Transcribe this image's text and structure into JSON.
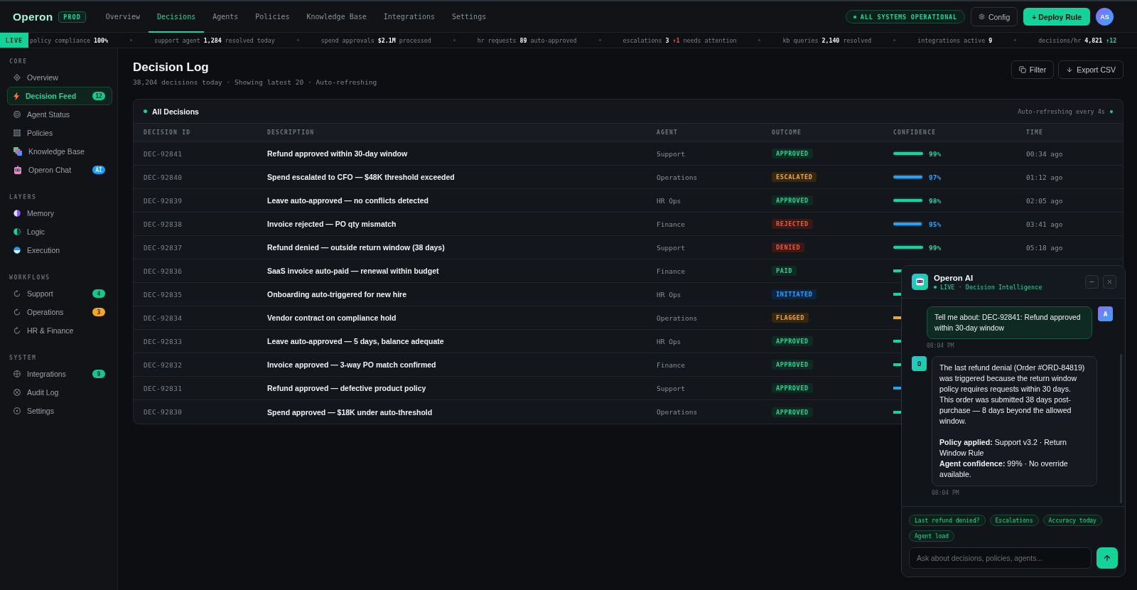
{
  "top_bar": {
    "logo": "Operon",
    "env_badge": "PROD",
    "tabs": [
      {
        "label": "Overview",
        "selected": false
      },
      {
        "label": "Decisions",
        "selected": true
      },
      {
        "label": "Agents",
        "selected": false
      },
      {
        "label": "Policies",
        "selected": false
      },
      {
        "label": "Knowledge Base",
        "selected": false
      },
      {
        "label": "Integrations",
        "selected": false
      },
      {
        "label": "Settings",
        "selected": false
      }
    ],
    "status": "ALL SYSTEMS OPERATIONAL",
    "config_button": "Config",
    "deploy_button": "+ Deploy Rule",
    "avatar": "AS"
  },
  "ticker": {
    "live_badge": "LIVE",
    "items": [
      {
        "label": "policy compliance",
        "value": "100%"
      },
      {
        "label": "support agent",
        "value": "1,284",
        "suffix": "resolved today"
      },
      {
        "label": "spend approvals",
        "value": "$2.1M",
        "suffix": "processed"
      },
      {
        "label": "hr requests",
        "value": "89",
        "suffix": "auto-approved"
      },
      {
        "label": "escalations",
        "value": "3",
        "delta": {
          "text": "↑1",
          "kind": "negative"
        },
        "suffix": "needs attention"
      },
      {
        "label": "kb queries",
        "value": "2,140",
        "suffix": "resolved"
      },
      {
        "label": "integrations active",
        "value": "9"
      },
      {
        "label": "decisions/hr",
        "value": "4,821",
        "delta": {
          "text": "↑12",
          "kind": "positive"
        }
      }
    ]
  },
  "sidebar": {
    "sections": [
      {
        "title": "CORE",
        "items": [
          {
            "label": "Overview",
            "selected": false
          },
          {
            "label": "Decision Feed",
            "selected": true,
            "badge": {
              "text": "12",
              "kind": "success"
            }
          },
          {
            "label": "Agent Status",
            "selected": false
          },
          {
            "label": "Policies",
            "selected": false
          },
          {
            "label": "Knowledge Base",
            "selected": false
          },
          {
            "label": "Operon Chat",
            "selected": false,
            "badge": {
              "text": "AI",
              "kind": "info"
            }
          }
        ]
      },
      {
        "title": "LAYERS",
        "items": [
          {
            "label": "Memory",
            "selected": false
          },
          {
            "label": "Logic",
            "selected": false
          },
          {
            "label": "Execution",
            "selected": false
          }
        ]
      },
      {
        "title": "WORKFLOWS",
        "items": [
          {
            "label": "Support",
            "selected": false,
            "badge": {
              "text": "4",
              "kind": "success"
            }
          },
          {
            "label": "Operations",
            "selected": false,
            "badge": {
              "text": "3",
              "kind": "warning"
            }
          },
          {
            "label": "HR & Finance",
            "selected": false
          }
        ]
      },
      {
        "title": "SYSTEM",
        "items": [
          {
            "label": "Integrations",
            "selected": false,
            "badge": {
              "text": "9",
              "kind": "success"
            }
          },
          {
            "label": "Audit Log",
            "selected": false
          },
          {
            "label": "Settings",
            "selected": false
          }
        ]
      }
    ]
  },
  "page": {
    "title": "Decision Log",
    "subtitle": "38,204 decisions today · Showing latest 20 · Auto-refreshing",
    "buttons": [
      {
        "label": "Filter",
        "kind": "filter"
      },
      {
        "label": "Export CSV",
        "kind": "export"
      }
    ]
  },
  "table": {
    "title": "All Decisions",
    "refresh_note": "Auto-refreshing every 4s",
    "columns": [
      "DECISION ID",
      "DESCRIPTION",
      "AGENT",
      "OUTCOME",
      "CONFIDENCE",
      "TIME"
    ],
    "rows": [
      {
        "id": "DEC-92841",
        "description": "Refund approved within 30-day window",
        "agent": "Support",
        "outcome": {
          "label": "APPROVED",
          "kind": "success"
        },
        "confidence": {
          "level": 0.99,
          "reading": "99%",
          "color": "#13d69b"
        },
        "time": "00:34 ago"
      },
      {
        "id": "DEC-92840",
        "description": "Spend escalated to CFO — $48K threshold exceeded",
        "agent": "Operations",
        "outcome": {
          "label": "ESCALATED",
          "kind": "warning"
        },
        "confidence": {
          "level": 0.97,
          "reading": "97%",
          "color": "#1ea6ff"
        },
        "time": "01:12 ago"
      },
      {
        "id": "DEC-92839",
        "description": "Leave auto-approved — no conflicts detected",
        "agent": "HR Ops",
        "outcome": {
          "label": "APPROVED",
          "kind": "success"
        },
        "confidence": {
          "level": 0.98,
          "reading": "98%",
          "color": "#13d69b"
        },
        "time": "02:05 ago"
      },
      {
        "id": "DEC-92838",
        "description": "Invoice rejected — PO qty mismatch",
        "agent": "Finance",
        "outcome": {
          "label": "REJECTED",
          "kind": "danger"
        },
        "confidence": {
          "level": 0.95,
          "reading": "95%",
          "color": "#1ea6ff"
        },
        "time": "03:41 ago"
      },
      {
        "id": "DEC-92837",
        "description": "Refund denied — outside return window (38 days)",
        "agent": "Support",
        "outcome": {
          "label": "DENIED",
          "kind": "danger"
        },
        "confidence": {
          "level": 0.99,
          "reading": "99%",
          "color": "#13d69b"
        },
        "time": "05:18 ago"
      },
      {
        "id": "DEC-92836",
        "description": "SaaS invoice auto-paid — renewal within budget",
        "agent": "Finance",
        "outcome": {
          "label": "PAID",
          "kind": "success"
        },
        "confidence": {
          "color": "#13d69b"
        }
      },
      {
        "id": "DEC-92835",
        "description": "Onboarding auto-triggered for new hire",
        "agent": "HR Ops",
        "outcome": {
          "label": "INITIATED",
          "kind": "info"
        },
        "confidence": {
          "color": "#13d69b"
        }
      },
      {
        "id": "DEC-92834",
        "description": "Vendor contract on compliance hold",
        "agent": "Operations",
        "outcome": {
          "label": "FLAGGED",
          "kind": "warning"
        },
        "confidence": {
          "color": "#f2a531"
        }
      },
      {
        "id": "DEC-92833",
        "description": "Leave auto-approved — 5 days, balance adequate",
        "agent": "HR Ops",
        "outcome": {
          "label": "APPROVED",
          "kind": "success"
        },
        "confidence": {
          "color": "#13d69b"
        }
      },
      {
        "id": "DEC-92832",
        "description": "Invoice approved — 3-way PO match confirmed",
        "agent": "Finance",
        "outcome": {
          "label": "APPROVED",
          "kind": "success"
        },
        "confidence": {
          "color": "#13d69b"
        }
      },
      {
        "id": "DEC-92831",
        "description": "Refund approved — defective product policy",
        "agent": "Support",
        "outcome": {
          "label": "APPROVED",
          "kind": "success"
        },
        "confidence": {
          "color": "#1ea6ff"
        }
      },
      {
        "id": "DEC-92830",
        "description": "Spend approved — $18K under auto-threshold",
        "agent": "Operations",
        "outcome": {
          "label": "APPROVED",
          "kind": "success"
        },
        "confidence": {
          "color": "#13d69b"
        }
      }
    ]
  },
  "chat": {
    "title": "Operon AI",
    "status": "LIVE · Decision Intelligence",
    "messages": [
      {
        "kind": "user",
        "avatar": "A",
        "paragraphs": [
          "Tell me about: DEC-92841: Refund approved within 30-day window"
        ],
        "time": "08:04 PM"
      },
      {
        "kind": "assistant",
        "avatar": "O",
        "paragraphs": [
          "The last refund denial (Order #ORD-84819) was triggered because the return window policy requires requests within 30 days. This order was submitted 38 days post-purchase — 8 days beyond the allowed window.",
          "**Policy applied:** Support v3.2 · Return Window Rule\n**Agent confidence:** 99% · No override available."
        ],
        "time": "08:04 PM"
      }
    ],
    "suggestions": [
      "Last refund denied?",
      "Escalations",
      "Accuracy today",
      "Agent load"
    ],
    "input": {
      "placeholder": "Ask about decisions, policies, agents..."
    }
  }
}
